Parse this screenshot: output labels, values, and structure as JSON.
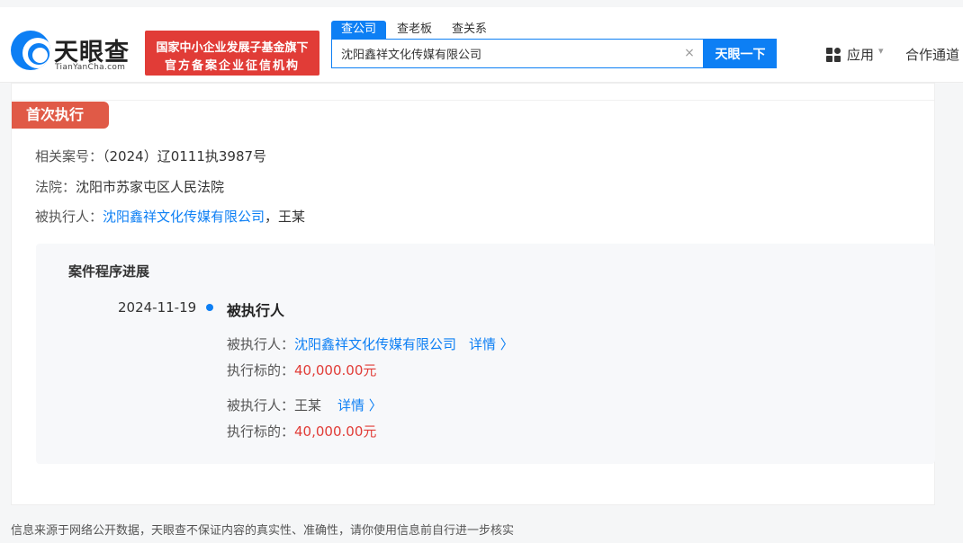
{
  "header": {
    "logo_text": "天眼查",
    "logo_sub": "TianYanCha.com",
    "badge_line1": "国家中小企业发展子基金旗下",
    "badge_line2": "官方备案企业征信机构",
    "tabs": [
      {
        "label": "查公司",
        "active": true
      },
      {
        "label": "查老板",
        "active": false
      },
      {
        "label": "查关系",
        "active": false
      }
    ],
    "search_value": "沈阳鑫祥文化传媒有限公司",
    "clear_glyph": "×",
    "search_button": "天眼一下",
    "apps_label": "应用",
    "apps_caret": "▾",
    "cooperate_label": "合作通道"
  },
  "record": {
    "tag": "首次执行",
    "case_no_label": "相关案号：",
    "case_no": "（2024）辽0111执3987号",
    "court_label": "法院：",
    "court": "沈阳市苏家屯区人民法院",
    "executed_label": "被执行人：",
    "executed_company": "沈阳鑫祥文化传媒有限公司",
    "executed_sep": "，",
    "executed_person": "王某"
  },
  "progress": {
    "title": "案件程序进展",
    "date": "2024-11-19",
    "role": "被执行人",
    "entries": [
      {
        "name_label": "被执行人：",
        "name": "沈阳鑫祥文化传媒有限公司",
        "name_is_link": true,
        "detail": "详情 〉",
        "amount_label": "执行标的：",
        "amount": "40,000.00元"
      },
      {
        "name_label": "被执行人：",
        "name": "王某",
        "name_is_link": false,
        "detail": "详情 〉",
        "amount_label": "执行标的：",
        "amount": "40,000.00元"
      }
    ]
  },
  "footer": {
    "disclaimer": "信息来源于网络公开数据，天眼查不保证内容的真实性、准确性，请你使用信息前自行进一步核实"
  },
  "colors": {
    "brand_blue": "#0d7ff4",
    "badge_red": "#e13c37",
    "tag_red": "#e05a47",
    "amount_red": "#e13c37"
  }
}
